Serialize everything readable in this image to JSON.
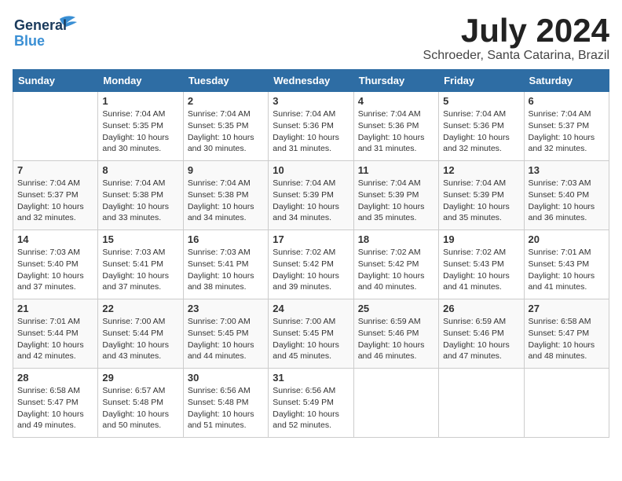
{
  "header": {
    "logo_line1": "General",
    "logo_line2": "Blue",
    "month_title": "July 2024",
    "location": "Schroeder, Santa Catarina, Brazil"
  },
  "days_of_week": [
    "Sunday",
    "Monday",
    "Tuesday",
    "Wednesday",
    "Thursday",
    "Friday",
    "Saturday"
  ],
  "weeks": [
    [
      {
        "num": "",
        "info": ""
      },
      {
        "num": "1",
        "info": "Sunrise: 7:04 AM\nSunset: 5:35 PM\nDaylight: 10 hours\nand 30 minutes."
      },
      {
        "num": "2",
        "info": "Sunrise: 7:04 AM\nSunset: 5:35 PM\nDaylight: 10 hours\nand 30 minutes."
      },
      {
        "num": "3",
        "info": "Sunrise: 7:04 AM\nSunset: 5:36 PM\nDaylight: 10 hours\nand 31 minutes."
      },
      {
        "num": "4",
        "info": "Sunrise: 7:04 AM\nSunset: 5:36 PM\nDaylight: 10 hours\nand 31 minutes."
      },
      {
        "num": "5",
        "info": "Sunrise: 7:04 AM\nSunset: 5:36 PM\nDaylight: 10 hours\nand 32 minutes."
      },
      {
        "num": "6",
        "info": "Sunrise: 7:04 AM\nSunset: 5:37 PM\nDaylight: 10 hours\nand 32 minutes."
      }
    ],
    [
      {
        "num": "7",
        "info": "Sunrise: 7:04 AM\nSunset: 5:37 PM\nDaylight: 10 hours\nand 32 minutes."
      },
      {
        "num": "8",
        "info": "Sunrise: 7:04 AM\nSunset: 5:38 PM\nDaylight: 10 hours\nand 33 minutes."
      },
      {
        "num": "9",
        "info": "Sunrise: 7:04 AM\nSunset: 5:38 PM\nDaylight: 10 hours\nand 34 minutes."
      },
      {
        "num": "10",
        "info": "Sunrise: 7:04 AM\nSunset: 5:39 PM\nDaylight: 10 hours\nand 34 minutes."
      },
      {
        "num": "11",
        "info": "Sunrise: 7:04 AM\nSunset: 5:39 PM\nDaylight: 10 hours\nand 35 minutes."
      },
      {
        "num": "12",
        "info": "Sunrise: 7:04 AM\nSunset: 5:39 PM\nDaylight: 10 hours\nand 35 minutes."
      },
      {
        "num": "13",
        "info": "Sunrise: 7:03 AM\nSunset: 5:40 PM\nDaylight: 10 hours\nand 36 minutes."
      }
    ],
    [
      {
        "num": "14",
        "info": "Sunrise: 7:03 AM\nSunset: 5:40 PM\nDaylight: 10 hours\nand 37 minutes."
      },
      {
        "num": "15",
        "info": "Sunrise: 7:03 AM\nSunset: 5:41 PM\nDaylight: 10 hours\nand 37 minutes."
      },
      {
        "num": "16",
        "info": "Sunrise: 7:03 AM\nSunset: 5:41 PM\nDaylight: 10 hours\nand 38 minutes."
      },
      {
        "num": "17",
        "info": "Sunrise: 7:02 AM\nSunset: 5:42 PM\nDaylight: 10 hours\nand 39 minutes."
      },
      {
        "num": "18",
        "info": "Sunrise: 7:02 AM\nSunset: 5:42 PM\nDaylight: 10 hours\nand 40 minutes."
      },
      {
        "num": "19",
        "info": "Sunrise: 7:02 AM\nSunset: 5:43 PM\nDaylight: 10 hours\nand 41 minutes."
      },
      {
        "num": "20",
        "info": "Sunrise: 7:01 AM\nSunset: 5:43 PM\nDaylight: 10 hours\nand 41 minutes."
      }
    ],
    [
      {
        "num": "21",
        "info": "Sunrise: 7:01 AM\nSunset: 5:44 PM\nDaylight: 10 hours\nand 42 minutes."
      },
      {
        "num": "22",
        "info": "Sunrise: 7:00 AM\nSunset: 5:44 PM\nDaylight: 10 hours\nand 43 minutes."
      },
      {
        "num": "23",
        "info": "Sunrise: 7:00 AM\nSunset: 5:45 PM\nDaylight: 10 hours\nand 44 minutes."
      },
      {
        "num": "24",
        "info": "Sunrise: 7:00 AM\nSunset: 5:45 PM\nDaylight: 10 hours\nand 45 minutes."
      },
      {
        "num": "25",
        "info": "Sunrise: 6:59 AM\nSunset: 5:46 PM\nDaylight: 10 hours\nand 46 minutes."
      },
      {
        "num": "26",
        "info": "Sunrise: 6:59 AM\nSunset: 5:46 PM\nDaylight: 10 hours\nand 47 minutes."
      },
      {
        "num": "27",
        "info": "Sunrise: 6:58 AM\nSunset: 5:47 PM\nDaylight: 10 hours\nand 48 minutes."
      }
    ],
    [
      {
        "num": "28",
        "info": "Sunrise: 6:58 AM\nSunset: 5:47 PM\nDaylight: 10 hours\nand 49 minutes."
      },
      {
        "num": "29",
        "info": "Sunrise: 6:57 AM\nSunset: 5:48 PM\nDaylight: 10 hours\nand 50 minutes."
      },
      {
        "num": "30",
        "info": "Sunrise: 6:56 AM\nSunset: 5:48 PM\nDaylight: 10 hours\nand 51 minutes."
      },
      {
        "num": "31",
        "info": "Sunrise: 6:56 AM\nSunset: 5:49 PM\nDaylight: 10 hours\nand 52 minutes."
      },
      {
        "num": "",
        "info": ""
      },
      {
        "num": "",
        "info": ""
      },
      {
        "num": "",
        "info": ""
      }
    ]
  ]
}
